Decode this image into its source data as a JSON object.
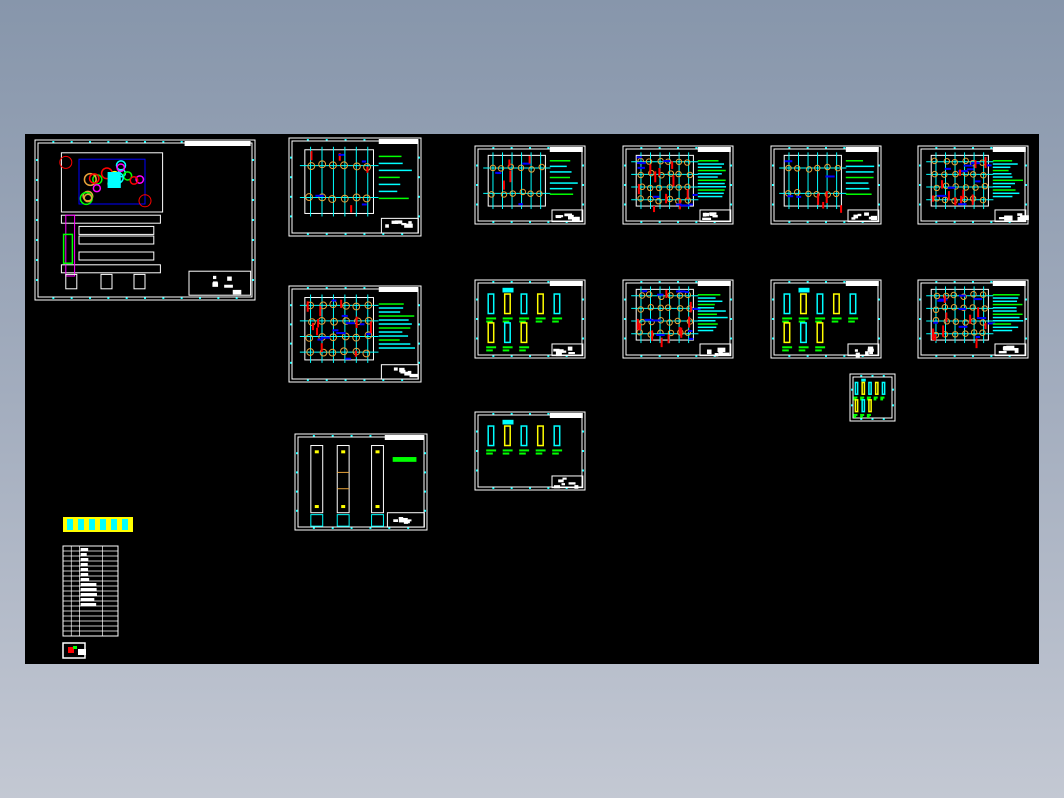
{
  "app": {
    "view": "CAD model space overview",
    "background_colors": {
      "top": "#8796ab",
      "bottom": "#c3c8d3"
    },
    "canvas_color": "#000000"
  },
  "palette": {
    "frame": "#ffffff",
    "cyan": "#00ffff",
    "yellow": "#ffff00",
    "green": "#00ff00",
    "red": "#ff0000",
    "blue": "#0000ff",
    "magenta": "#ff00ff",
    "orange": "#e8a33a"
  },
  "sheets": [
    {
      "id": "assembly-drawing",
      "kind": "assembly",
      "density": "high"
    },
    {
      "id": "plan-sheet-a",
      "kind": "plan",
      "density": "medium"
    },
    {
      "id": "plan-sheet-b",
      "kind": "plan",
      "density": "high"
    },
    {
      "id": "elevation-sheet",
      "kind": "elevation",
      "density": "low"
    },
    {
      "id": "plan-sheet-c",
      "kind": "plan",
      "density": "medium"
    },
    {
      "id": "plan-sheet-d",
      "kind": "plan",
      "density": "high"
    },
    {
      "id": "plan-sheet-e",
      "kind": "plan",
      "density": "medium"
    },
    {
      "id": "plan-sheet-f",
      "kind": "plan",
      "density": "high"
    },
    {
      "id": "detail-sheet-a",
      "kind": "detail",
      "density": "medium"
    },
    {
      "id": "plan-sheet-g",
      "kind": "plan",
      "density": "high"
    },
    {
      "id": "detail-sheet-b",
      "kind": "detail",
      "density": "medium"
    },
    {
      "id": "plan-sheet-h",
      "kind": "plan",
      "density": "high"
    },
    {
      "id": "detail-sheet-c",
      "kind": "detail",
      "density": "low"
    },
    {
      "id": "detail-sheet-small",
      "kind": "detail-small",
      "density": "medium"
    }
  ],
  "tables": [
    {
      "id": "legend-table",
      "kind": "legend-bar"
    },
    {
      "id": "parts-list",
      "kind": "bom",
      "rows": 18
    },
    {
      "id": "mini-preview",
      "kind": "thumbnail"
    }
  ]
}
